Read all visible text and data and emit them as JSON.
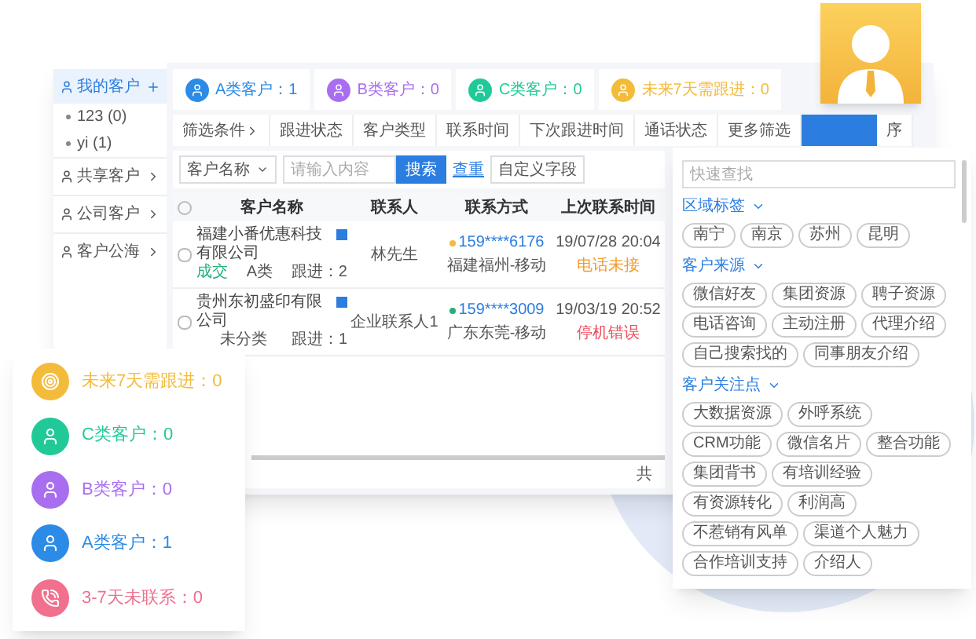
{
  "sidebar": {
    "items": [
      {
        "label": "我的客户",
        "selected": true,
        "kind": "head"
      },
      {
        "label": "123 (0)",
        "selected": false,
        "kind": "sub"
      },
      {
        "label": "yi (1)",
        "selected": false,
        "kind": "sub"
      },
      {
        "label": "共享客户",
        "selected": false,
        "kind": "group"
      },
      {
        "label": "公司客户",
        "selected": false,
        "kind": "group"
      },
      {
        "label": "客户公海",
        "selected": false,
        "kind": "group"
      }
    ]
  },
  "stat_tabs": [
    {
      "label": "A类客户：1",
      "color": "#2b8be6"
    },
    {
      "label": "B类客户：0",
      "color": "#a96ef0"
    },
    {
      "label": "C类客户：0",
      "color": "#22c998"
    },
    {
      "label": "未来7天需跟进：0",
      "color": "#f3bb3a"
    }
  ],
  "filters": [
    {
      "label": "筛选条件",
      "selected": false
    },
    {
      "label": "跟进状态",
      "selected": false
    },
    {
      "label": "客户类型",
      "selected": false
    },
    {
      "label": "联系时间",
      "selected": false
    },
    {
      "label": "下次跟进时间",
      "selected": false
    },
    {
      "label": "通话状态",
      "selected": false
    },
    {
      "label": "更多筛选",
      "selected": false
    },
    {
      "selected": true
    },
    {
      "label": "序",
      "selected": false
    }
  ],
  "search": {
    "field": "客户名称",
    "placeholder": "请输入内容",
    "button": "搜索",
    "link": "查重",
    "custom": "自定义字段"
  },
  "table": {
    "header_checked": false,
    "columns": [
      "客户名称",
      "联系人",
      "联系方式",
      "上次联系时间"
    ],
    "rows": [
      {
        "checked": false,
        "company": "福建小番优惠科技有限公司",
        "status": "成交",
        "type": "A类",
        "follow": "跟进：2",
        "contact": "林先生",
        "phone": {
          "text": "159****6176",
          "color": "#f3bb3a"
        },
        "region": "福建福州-移动",
        "time": "19/07/28 20:04",
        "call": {
          "text": "电话未接",
          "color": "#f39a2b"
        }
      },
      {
        "checked": false,
        "company": "贵州东初盛印有限公司",
        "type": "未分类",
        "follow": "跟进：1",
        "contact": "企业联系人1",
        "phone": {
          "text": "159****3009",
          "color": "#22b07a"
        },
        "region": "广东东莞-移动",
        "time": "19/03/19 20:52",
        "call": {
          "text": "停机错误",
          "color": "#ee4b5a"
        }
      }
    ],
    "footer": "共"
  },
  "filter_panel": {
    "placeholder": "快速查找",
    "sections": [
      {
        "title": "区域标签",
        "expanded": true,
        "tags": [
          "南宁",
          "南京",
          "苏州",
          "昆明"
        ]
      },
      {
        "title": "客户来源",
        "expanded": true,
        "tags": [
          "微信好友",
          "集团资源",
          "聘子资源",
          "电话咨询",
          "主动注册",
          "代理介绍",
          "自己搜索找的",
          "同事朋友介绍"
        ]
      },
      {
        "title": "客户关注点",
        "expanded": true,
        "tags": [
          "大数据资源",
          "外呼系统",
          "CRM功能",
          "微信名片",
          "整合功能",
          "集团背书",
          "有培训经验",
          "有资源转化",
          "利润高",
          "不惹销有风单",
          "渠道个人魅力",
          "合作培训支持",
          "介绍人"
        ]
      }
    ]
  },
  "stats_card": [
    {
      "label": "未来7天需跟进：0",
      "color": "#f3bb3a",
      "kind": "target"
    },
    {
      "label": "C类客户：0",
      "color": "#22c998",
      "kind": "user"
    },
    {
      "label": "B类客户：0",
      "color": "#a96ef0",
      "kind": "user"
    },
    {
      "label": "A类客户：1",
      "color": "#2b8be6",
      "kind": "user"
    },
    {
      "label": "3-7天未联系：0",
      "color": "#f0708e",
      "kind": "phone"
    }
  ]
}
